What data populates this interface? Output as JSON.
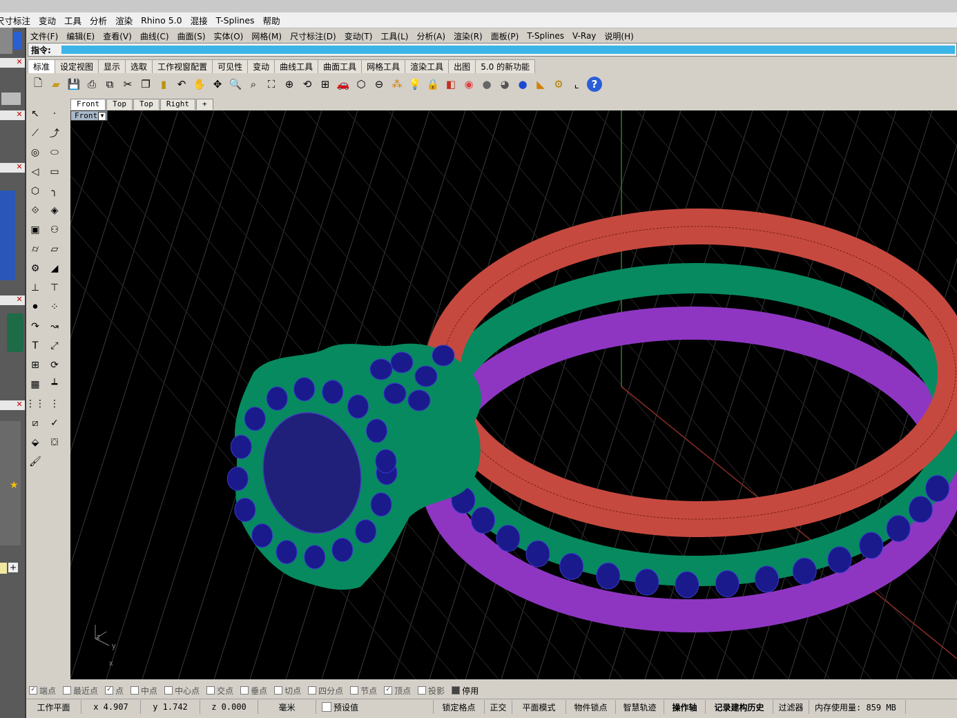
{
  "top_menu": [
    "尺寸标注",
    "变动",
    "工具",
    "分析",
    "渲染",
    "Rhino 5.0",
    "混接",
    "T-Splines",
    "帮助"
  ],
  "menu": [
    "文件(F)",
    "编辑(E)",
    "查看(V)",
    "曲线(C)",
    "曲面(S)",
    "实体(O)",
    "网格(M)",
    "尺寸标注(D)",
    "变动(T)",
    "工具(L)",
    "分析(A)",
    "渲染(R)",
    "面板(P)",
    "T-Splines",
    "V-Ray",
    "说明(H)"
  ],
  "command": {
    "label": "指令:",
    "value": ""
  },
  "toolbar_tabs": [
    "标准",
    "设定视图",
    "显示",
    "选取",
    "工作视窗配置",
    "可见性",
    "变动",
    "曲线工具",
    "曲面工具",
    "网格工具",
    "渲染工具",
    "出图",
    "5.0 的新功能"
  ],
  "viewport_tabs": [
    "Front",
    "Top",
    "Top",
    "Right",
    "+"
  ],
  "viewport_title": "Front",
  "axis_labels": {
    "z": "z",
    "y": "y",
    "x": "x"
  },
  "osnaps": [
    {
      "label": "端点",
      "checked": true
    },
    {
      "label": "最近点",
      "checked": false
    },
    {
      "label": "点",
      "checked": true
    },
    {
      "label": "中点",
      "checked": false
    },
    {
      "label": "中心点",
      "checked": false
    },
    {
      "label": "交点",
      "checked": false
    },
    {
      "label": "垂点",
      "checked": false
    },
    {
      "label": "切点",
      "checked": false
    },
    {
      "label": "四分点",
      "checked": false
    },
    {
      "label": "节点",
      "checked": false
    },
    {
      "label": "顶点",
      "checked": true
    },
    {
      "label": "投影",
      "checked": false
    },
    {
      "label": "停用",
      "checked": false
    }
  ],
  "status": {
    "cplane": "工作平面",
    "x": "x 4.907",
    "y": "y 1.742",
    "z": "z 0.000",
    "units": "毫米",
    "layer": "预设值",
    "grid_snap": "锁定格点",
    "ortho": "正交",
    "planar": "平面模式",
    "osnap": "物件锁点",
    "smarttrack": "智慧轨迹",
    "gumball": "操作轴",
    "history": "记录建构历史",
    "filter": "过滤器",
    "memory": "内存使用量: 859 MB"
  },
  "colors": {
    "command_field": "#3cb5e6",
    "viewport_bg": "#000000",
    "band_red": "#c6493f",
    "band_green": "#078a5f",
    "band_purple": "#8e36c2",
    "gem_blue": "#1a1a8c"
  }
}
